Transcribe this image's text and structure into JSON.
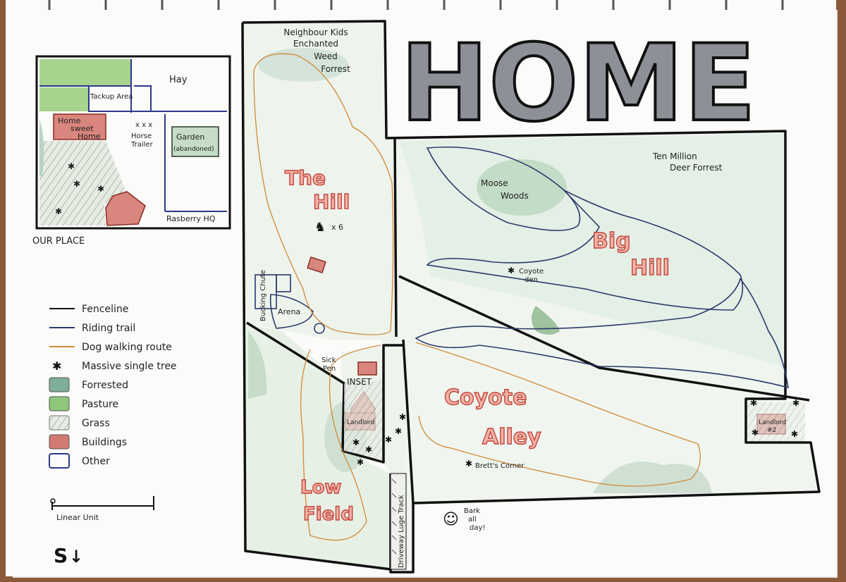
{
  "title": "HOME",
  "inset": {
    "caption": "OUR PLACE",
    "labels": {
      "hay": "Hay",
      "tackup": "Tackup Area",
      "home_line1": "Home",
      "home_line2": "sweet",
      "home_line3": "Home",
      "horse_marks": "x x x",
      "horse_line1": "Horse",
      "horse_line2": "Trailer",
      "garden_line1": "Garden",
      "garden_line2": "(abandoned)",
      "rasberry": "Rasberry HQ"
    }
  },
  "legend": {
    "items": [
      {
        "label": "Fenceline",
        "kind": "line",
        "color": "#111111"
      },
      {
        "label": "Riding trail",
        "kind": "line",
        "color": "#2a3a6a"
      },
      {
        "label": "Dog walking route",
        "kind": "line",
        "color": "#d08a3a"
      },
      {
        "label": "Massive single tree",
        "kind": "star",
        "color": "#111111"
      },
      {
        "label": "Forrested",
        "kind": "swatch",
        "color": "#7fae9a"
      },
      {
        "label": "Pasture",
        "kind": "swatch",
        "color": "#8fc77a"
      },
      {
        "label": "Grass",
        "kind": "hatch",
        "color": "#a8b8a8"
      },
      {
        "label": "Buildings",
        "kind": "swatch",
        "color": "#d27a72"
      },
      {
        "label": "Other",
        "kind": "outline",
        "color": "#2a3a8a"
      }
    ],
    "scale_label": "Linear Unit"
  },
  "signature": "S",
  "map_labels": {
    "neighbour_line1": "Neighbour Kids",
    "neighbour_line2": "Enchanted",
    "neighbour_line3": "Weed",
    "neighbour_line4": "Forrest",
    "the_hill_1": "The",
    "the_hill_2": "Hill",
    "horses_count": "x 6",
    "bucking_chute": "Bucking Chute",
    "arena": "Arena",
    "sick_pen_1": "Sick",
    "sick_pen_2": "Pen",
    "inset_box": "INSET",
    "landlord_1": "Landlord",
    "low_field_1": "Low",
    "low_field_2": "Field",
    "driveway": "Driveway Luge Track",
    "ten_million_1": "Ten Million",
    "ten_million_2": "Deer Forrest",
    "moose_1": "Moose",
    "moose_2": "Woods",
    "big_hill_1": "Big",
    "big_hill_2": "Hill",
    "coyote_den_1": "Coyote",
    "coyote_den_2": "den",
    "coyote_alley_1": "Coyote",
    "coyote_alley_2": "Alley",
    "bretts_corner": "Brett's Corner",
    "landlord2_1": "Landlord",
    "landlord2_2": "#2",
    "bark_1": "Bark",
    "bark_2": "all",
    "bark_3": "day!"
  },
  "colors": {
    "forest": "#b9d4c4",
    "pasture": "#a7d38f",
    "building": "#d8867e",
    "title_fill": "#8e9098"
  }
}
